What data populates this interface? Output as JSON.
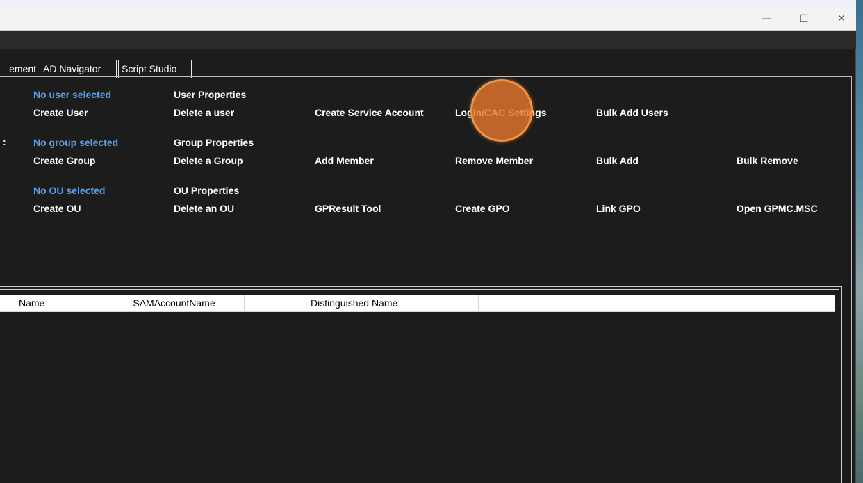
{
  "window": {
    "controls": {
      "minimize": "—",
      "maximize": "☐",
      "close": "✕"
    }
  },
  "tabs": [
    "ement",
    "AD Navigator",
    "Script Studio"
  ],
  "user_section": {
    "status": "No user selected",
    "properties": "User Properties",
    "actions": [
      "Create User",
      "Delete a user",
      "Create Service Account",
      "Login/CAC Settings",
      "Bulk Add Users"
    ]
  },
  "group_section": {
    "separator": ":",
    "status": "No group selected",
    "properties": "Group Properties",
    "actions": [
      "Create Group",
      "Delete a Group",
      "Add Member",
      "Remove Member",
      "Bulk Add",
      "Bulk Remove"
    ]
  },
  "ou_section": {
    "status": "No OU selected",
    "properties": "OU Properties",
    "actions": [
      "Create OU",
      "Delete an OU",
      "GPResult Tool",
      "Create GPO",
      "Link GPO",
      "Open GPMC.MSC"
    ]
  },
  "grid": {
    "columns": [
      "Name",
      "SAMAccountName",
      "Distinguished Name",
      ""
    ],
    "rows": []
  },
  "colors": {
    "background": "#1c1c1c",
    "status_blue": "#56a0ee",
    "click_indicator": "#e2762c"
  }
}
